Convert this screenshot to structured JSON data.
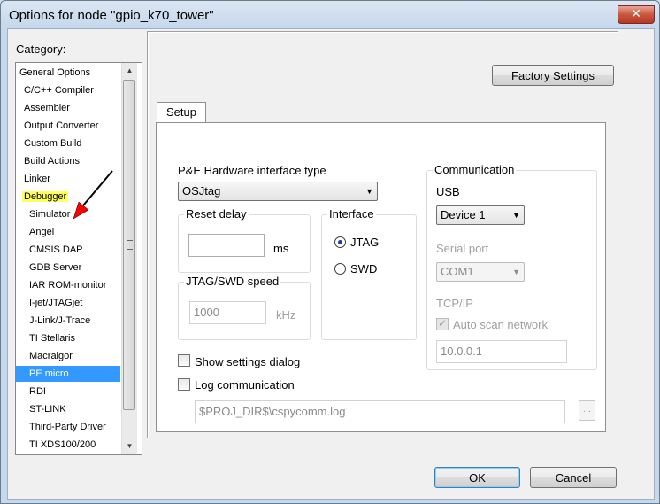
{
  "window": {
    "title": "Options for node \"gpio_k70_tower\"",
    "close_glyph": "✕"
  },
  "category": {
    "label": "Category:",
    "items": [
      {
        "label": "General Options",
        "indent": 0
      },
      {
        "label": "C/C++ Compiler",
        "indent": 1
      },
      {
        "label": "Assembler",
        "indent": 1
      },
      {
        "label": "Output Converter",
        "indent": 1
      },
      {
        "label": "Custom Build",
        "indent": 1
      },
      {
        "label": "Build Actions",
        "indent": 1
      },
      {
        "label": "Linker",
        "indent": 1
      },
      {
        "label": "Debugger",
        "indent": 1,
        "highlight": true
      },
      {
        "label": "Simulator",
        "indent": 2
      },
      {
        "label": "Angel",
        "indent": 2
      },
      {
        "label": "CMSIS DAP",
        "indent": 2
      },
      {
        "label": "GDB Server",
        "indent": 2
      },
      {
        "label": "IAR ROM-monitor",
        "indent": 2
      },
      {
        "label": "I-jet/JTAGjet",
        "indent": 2
      },
      {
        "label": "J-Link/J-Trace",
        "indent": 2
      },
      {
        "label": "TI Stellaris",
        "indent": 2
      },
      {
        "label": "Macraigor",
        "indent": 2
      },
      {
        "label": "PE micro",
        "indent": 2,
        "selected": true
      },
      {
        "label": "RDI",
        "indent": 2
      },
      {
        "label": "ST-LINK",
        "indent": 2
      },
      {
        "label": "Third-Party Driver",
        "indent": 2
      },
      {
        "label": "TI XDS100/200",
        "indent": 2
      }
    ],
    "scroll_up": "▲",
    "scroll_down": "▼"
  },
  "factory_settings_label": "Factory Settings",
  "tabs": [
    {
      "label": "Setup",
      "active": true
    }
  ],
  "setup": {
    "hw_type_label": "P&E Hardware interface type",
    "hw_type_value": "OSJtag",
    "reset_delay": {
      "title": "Reset delay",
      "value": "",
      "unit": "ms"
    },
    "interface": {
      "title": "Interface",
      "options": [
        {
          "label": "JTAG",
          "checked": true
        },
        {
          "label": "SWD",
          "checked": false
        }
      ]
    },
    "speed": {
      "title": "JTAG/SWD speed",
      "value": "1000",
      "unit": "kHz"
    },
    "communication": {
      "title": "Communication",
      "usb_label": "USB",
      "usb_device": "Device 1",
      "serial_label": "Serial port",
      "serial_value": "COM1",
      "tcpip_label": "TCP/IP",
      "auto_scan_label": "Auto scan network",
      "auto_scan_checked": true,
      "ip_value": "10.0.0.1"
    },
    "show_settings_label": "Show settings dialog",
    "show_settings_checked": false,
    "log_comm_label": "Log communication",
    "log_comm_checked": false,
    "log_path": "$PROJ_DIR$\\cspycomm.log",
    "browse_label": "..."
  },
  "buttons": {
    "ok": "OK",
    "cancel": "Cancel"
  },
  "annotation": {
    "arrow_color": "#ff0000"
  }
}
